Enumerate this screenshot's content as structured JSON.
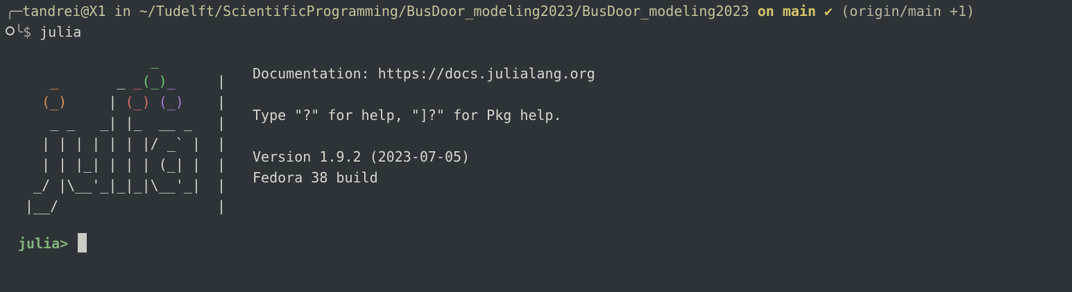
{
  "shell": {
    "corner_top": "╭─",
    "corner_bottom": "╰",
    "user_host": "tandrei@X1",
    "in_word": " in ",
    "cwd": "~/Tudelft/ScientificProgramming/BusDoor_modeling2023/BusDoor_modeling2023",
    "on_branch": " on main ✔",
    "remote_status": " (origin/main +1)",
    "dollar": "$ ",
    "command": "julia"
  },
  "julia_banner": {
    "info_lines": [
      {
        "text": "Documentation: https://docs.julialang.org"
      },
      {
        "text": "Type \"?\" for help, \"]?\" for Pkg help."
      },
      {
        "text": "Version 1.9.2 (2023-07-05)"
      },
      {
        "text": "Fedora 38 build"
      }
    ]
  },
  "repl": {
    "prompt": "julia>"
  },
  "colors": {
    "background": "#2e3338",
    "julia_green": "#6ec277",
    "julia_red": "#d46a6a",
    "julia_purple": "#a57fd0",
    "julia_orange": "#d6925a",
    "prompt_green": "#83b37c"
  }
}
